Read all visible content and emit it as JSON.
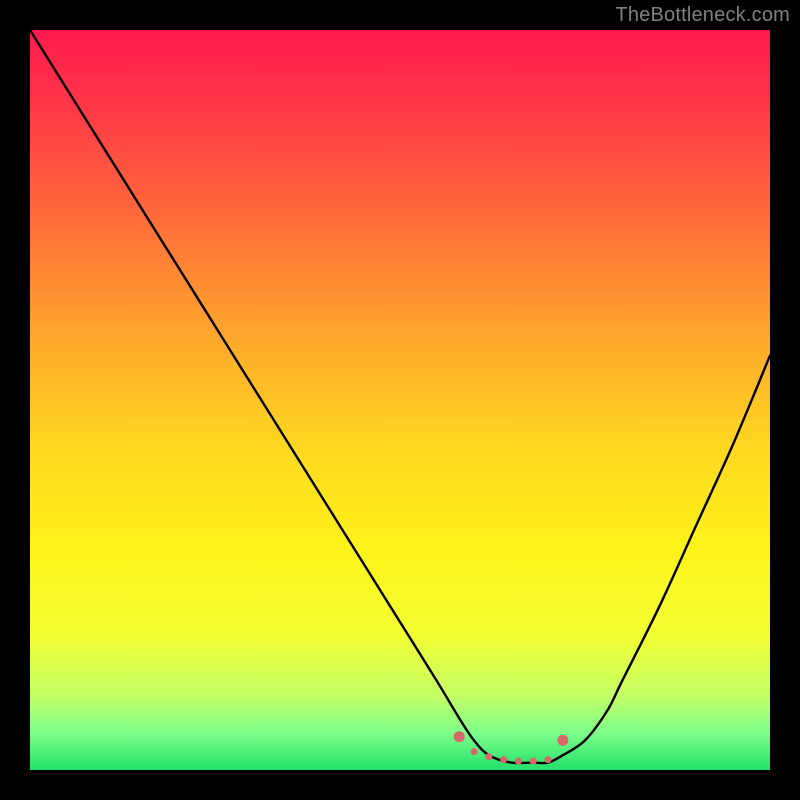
{
  "attribution": "TheBottleneck.com",
  "chart_data": {
    "type": "line",
    "title": "",
    "xlabel": "",
    "ylabel": "",
    "xlim": [
      0,
      100
    ],
    "ylim": [
      0,
      100
    ],
    "series": [
      {
        "name": "bottleneck-curve",
        "x": [
          0,
          5,
          10,
          15,
          20,
          25,
          30,
          35,
          40,
          45,
          50,
          55,
          58,
          60,
          62,
          65,
          68,
          70,
          72,
          75,
          78,
          80,
          85,
          90,
          95,
          100
        ],
        "values": [
          100,
          92,
          84,
          76,
          68,
          60,
          52,
          44,
          36,
          28,
          20,
          12,
          7,
          4,
          2,
          1,
          1,
          1,
          2,
          4,
          8,
          12,
          22,
          33,
          44,
          56
        ]
      }
    ],
    "markers": {
      "name": "highlight-band",
      "color": "#d9676a",
      "points": [
        {
          "x": 58,
          "y": 4.5
        },
        {
          "x": 60,
          "y": 2.5
        },
        {
          "x": 62,
          "y": 1.8
        },
        {
          "x": 64,
          "y": 1.4
        },
        {
          "x": 66,
          "y": 1.2
        },
        {
          "x": 68,
          "y": 1.2
        },
        {
          "x": 70,
          "y": 1.4
        },
        {
          "x": 72,
          "y": 4.0
        }
      ]
    },
    "gradient_stops": [
      {
        "offset": 0.0,
        "color": "#ff1a4d"
      },
      {
        "offset": 0.1,
        "color": "#ff3648"
      },
      {
        "offset": 0.25,
        "color": "#ff6a3a"
      },
      {
        "offset": 0.4,
        "color": "#ffa22e"
      },
      {
        "offset": 0.55,
        "color": "#ffd421"
      },
      {
        "offset": 0.7,
        "color": "#fff31a"
      },
      {
        "offset": 0.82,
        "color": "#f2ff34"
      },
      {
        "offset": 0.9,
        "color": "#c4ff66"
      },
      {
        "offset": 0.95,
        "color": "#7dff8a"
      },
      {
        "offset": 1.0,
        "color": "#22e06a"
      }
    ]
  }
}
